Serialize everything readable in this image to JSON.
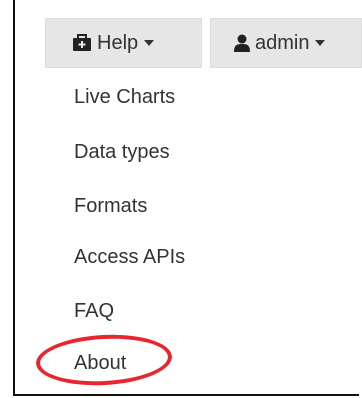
{
  "header": {
    "help_label": "Help",
    "admin_label": "admin"
  },
  "menu": {
    "items": [
      {
        "label": "Live Charts"
      },
      {
        "label": "Data types"
      },
      {
        "label": "Formats"
      },
      {
        "label": "Access APIs"
      },
      {
        "label": "FAQ"
      },
      {
        "label": "About"
      }
    ]
  },
  "icons": {
    "help": "medkit-icon",
    "admin": "user-icon",
    "dropdown": "caret-down-icon"
  },
  "colors": {
    "button_bg": "#e6e6e6",
    "text": "#333333",
    "highlight": "#e8262f",
    "frame": "#111111"
  }
}
